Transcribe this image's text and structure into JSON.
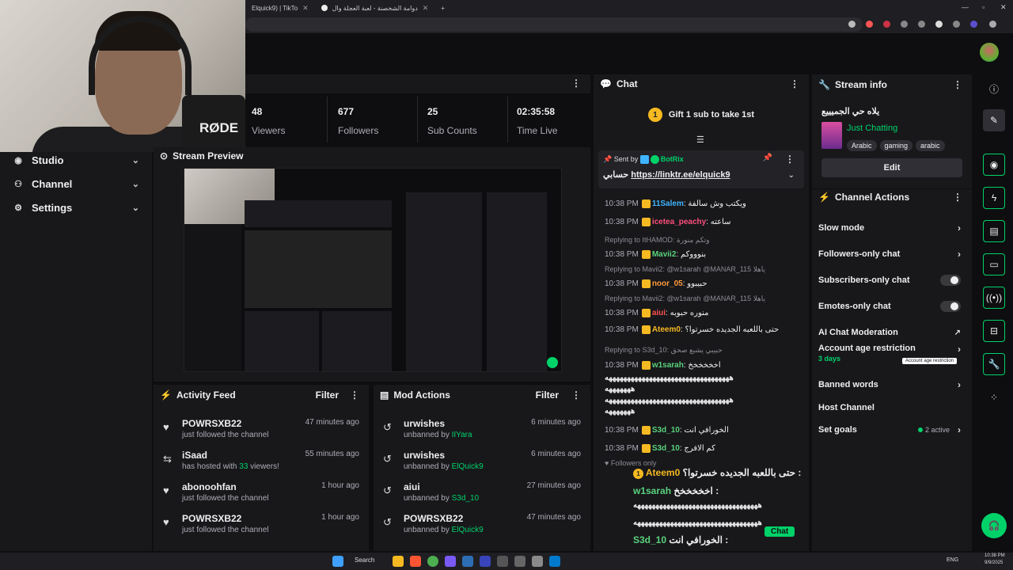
{
  "browser": {
    "tabs": [
      {
        "label": "Elquick9) | TikTo"
      },
      {
        "label": "دوامة الشخصنة - لعبة العجلة وال"
      }
    ],
    "new_tab": "+"
  },
  "webcam": {
    "mic_brand": "RØDE"
  },
  "nav": [
    {
      "label": "Studio"
    },
    {
      "label": "Channel"
    },
    {
      "label": "Settings"
    }
  ],
  "stats": [
    {
      "value": "48",
      "label": "Viewers"
    },
    {
      "value": "677",
      "label": "Followers"
    },
    {
      "value": "25",
      "label": "Sub Counts"
    },
    {
      "value": "02:35:58",
      "label": "Time Live"
    }
  ],
  "preview": {
    "title": "Stream Preview"
  },
  "activity_feed": {
    "title": "Activity Feed",
    "filter": "Filter",
    "items": [
      {
        "name": "POWRSXB22",
        "desc": "just followed the channel",
        "time": "47 minutes ago"
      },
      {
        "name": "iSaad",
        "desc_pre": "has hosted with ",
        "desc_count": "33",
        "desc_post": " viewers!",
        "time": "55 minutes ago"
      },
      {
        "name": "abonoohfan",
        "desc": "just followed the channel",
        "time": "1 hour ago"
      },
      {
        "name": "POWRSXB22",
        "desc": "just followed the channel",
        "time": "1 hour ago"
      }
    ]
  },
  "mod_actions": {
    "title": "Mod Actions",
    "filter": "Filter",
    "items": [
      {
        "name": "urwishes",
        "by_pre": "unbanned by ",
        "by": "IIYara",
        "time": "6 minutes ago"
      },
      {
        "name": "urwishes",
        "by_pre": "unbanned by ",
        "by": "ElQuick9",
        "time": "6 minutes ago"
      },
      {
        "name": "aiui",
        "by_pre": "unbanned by ",
        "by": "S3d_10",
        "time": "27 minutes ago"
      },
      {
        "name": "POWRSXB22",
        "by_pre": "unbanned by ",
        "by": "ElQuick9",
        "time": "47 minutes ago"
      }
    ]
  },
  "chat": {
    "title": "Chat",
    "gift_text": "Gift 1 sub to take 1st",
    "gift_coin": "1",
    "pinned": {
      "sent_by_label": "Sent by",
      "sender": "BotRix",
      "text_ar": "حسابي",
      "link": "https://linktr.ee/elquick9"
    },
    "messages": [
      {
        "time": "10:38 PM",
        "user": "11Salem",
        "color": "#3fb5ff",
        "text": "ويكتب وش سالفة"
      },
      {
        "time": "10:38 PM",
        "user": "icetea_peachy",
        "color": "#ff4f7b",
        "text": "ساعته"
      },
      {
        "reply": "Replying to ItHAMOD: وتكم منورة"
      },
      {
        "time": "10:38 PM",
        "user": "Mavii2",
        "color": "#5ad37c",
        "text": "بنوووكم"
      },
      {
        "reply": "Replying to Mavii2: @w1sarah @MANAR_115 ياهلا"
      },
      {
        "time": "10:38 PM",
        "user": "noor_05",
        "color": "#ff9a3c",
        "text": "حبيبوو"
      },
      {
        "reply": "Replying to Mavii2: @w1sarah @MANAR_115 ياهلا"
      },
      {
        "time": "10:38 PM",
        "user": "aiui",
        "color": "#ff4f4f",
        "text": "منوره حبوبه"
      },
      {
        "time": "10:38 PM",
        "user": "Ateem0",
        "color": "#f5b921",
        "text": "حتى باللعبه الجديده خسرتوا؟"
      },
      {
        "reply": "Replying to S3d_10: حبيبي يشبع صحق"
      },
      {
        "time": "10:38 PM",
        "user": "w1sarah",
        "color": "#5ad37c",
        "text": "اخخخخخخ"
      },
      {
        "time": "10:38 PM",
        "user": "S3d_10",
        "color": "#5ad37c",
        "text": "الخورافي انت"
      },
      {
        "time": "10:38 PM",
        "user": "S3d_10",
        "color": "#5ad37c",
        "text": "كم الافرج"
      }
    ],
    "spam_line": "ههههههههههههههههههههههههههههههههههه",
    "spam_short": "هههههههه",
    "followers_only": "Followers only"
  },
  "overlay": {
    "lines": [
      {
        "user": "Ateem0",
        "text": "حتى باللعبه الجديده خسرتوا؟ :"
      },
      {
        "user": "w1sarah",
        "text": "اخخخخخخ :"
      },
      {
        "user": "S3d_10",
        "text": "الخورافي انت :"
      },
      {
        "user": "S3d_10",
        "text": "كم الافرج :"
      }
    ],
    "chat_button": "Chat"
  },
  "stream_info": {
    "title": "Stream info",
    "stream_title": "يلاه حي الجميييع",
    "category": "Just Chatting",
    "tags": [
      "Arabic",
      "gaming",
      "arabic"
    ],
    "edit": "Edit"
  },
  "channel_actions": {
    "title": "Channel Actions",
    "rows": [
      {
        "label": "Slow mode"
      },
      {
        "label": "Followers-only chat"
      },
      {
        "label": "Subscribers-only chat"
      },
      {
        "label": "Emotes-only chat"
      },
      {
        "label": "AI Chat Moderation"
      },
      {
        "label": "Account age restriction",
        "sub": "3 days",
        "tooltip": "Account age restriction"
      },
      {
        "label": "Banned words"
      },
      {
        "label": "Host Channel"
      },
      {
        "label": "Set goals",
        "status": "2 active"
      }
    ]
  },
  "taskbar": {
    "search": "Search",
    "lang": "ENG",
    "time": "10:38 PM",
    "date": "9/9/2025"
  },
  "colors": {
    "accent": "#00d26a",
    "bg": "#0e0e10",
    "panel": "#18181b"
  }
}
